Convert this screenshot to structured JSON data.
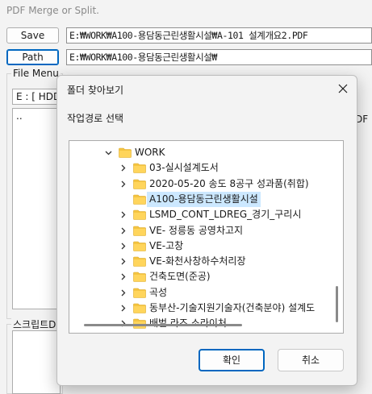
{
  "app": {
    "title": "PDF Merge or Split.",
    "save_label": "Save",
    "save_path": "E:₩WORK₩A100-용담동근린생활시설₩A-101 설계개요2.PDF",
    "path_label": "Path",
    "work_path": "E:₩WORK₩A100-용담동근린생활시설₩",
    "file_menu_label": "File Menu",
    "drive_value": "E : [ HDD",
    "file_list_item": "..",
    "right_peek": "DF",
    "script_label": "스크립트D"
  },
  "dialog": {
    "title": "폴더 찾아보기",
    "prompt": "작업경로 선택",
    "ok_label": "확인",
    "cancel_label": "취소",
    "tree": [
      {
        "label": "WORK",
        "level": 0,
        "expanded": true
      },
      {
        "label": "03-실시설계도서",
        "level": 1
      },
      {
        "label": "2020-05-20 송도 8공구 성과품(취합)",
        "level": 1
      },
      {
        "label": "A100-용담동근린생활시설",
        "level": 1,
        "selected": true
      },
      {
        "label": "LSMD_CONT_LDREG_경기_구리시",
        "level": 1
      },
      {
        "label": "VE- 정릉동 공영차고지",
        "level": 1
      },
      {
        "label": "VE-고창",
        "level": 1
      },
      {
        "label": "VE-화천사창하수처리장",
        "level": 1
      },
      {
        "label": "건축도면(준공)",
        "level": 1
      },
      {
        "label": "곡성",
        "level": 1
      },
      {
        "label": "동부산-기술지원기술자(건축분야) 설계도",
        "level": 1
      },
      {
        "label": "배벌 라즈 소라이처",
        "level": 1
      }
    ]
  },
  "colors": {
    "accent": "#0067c0",
    "selection": "#cce8ff",
    "folder": "#f5c542"
  }
}
